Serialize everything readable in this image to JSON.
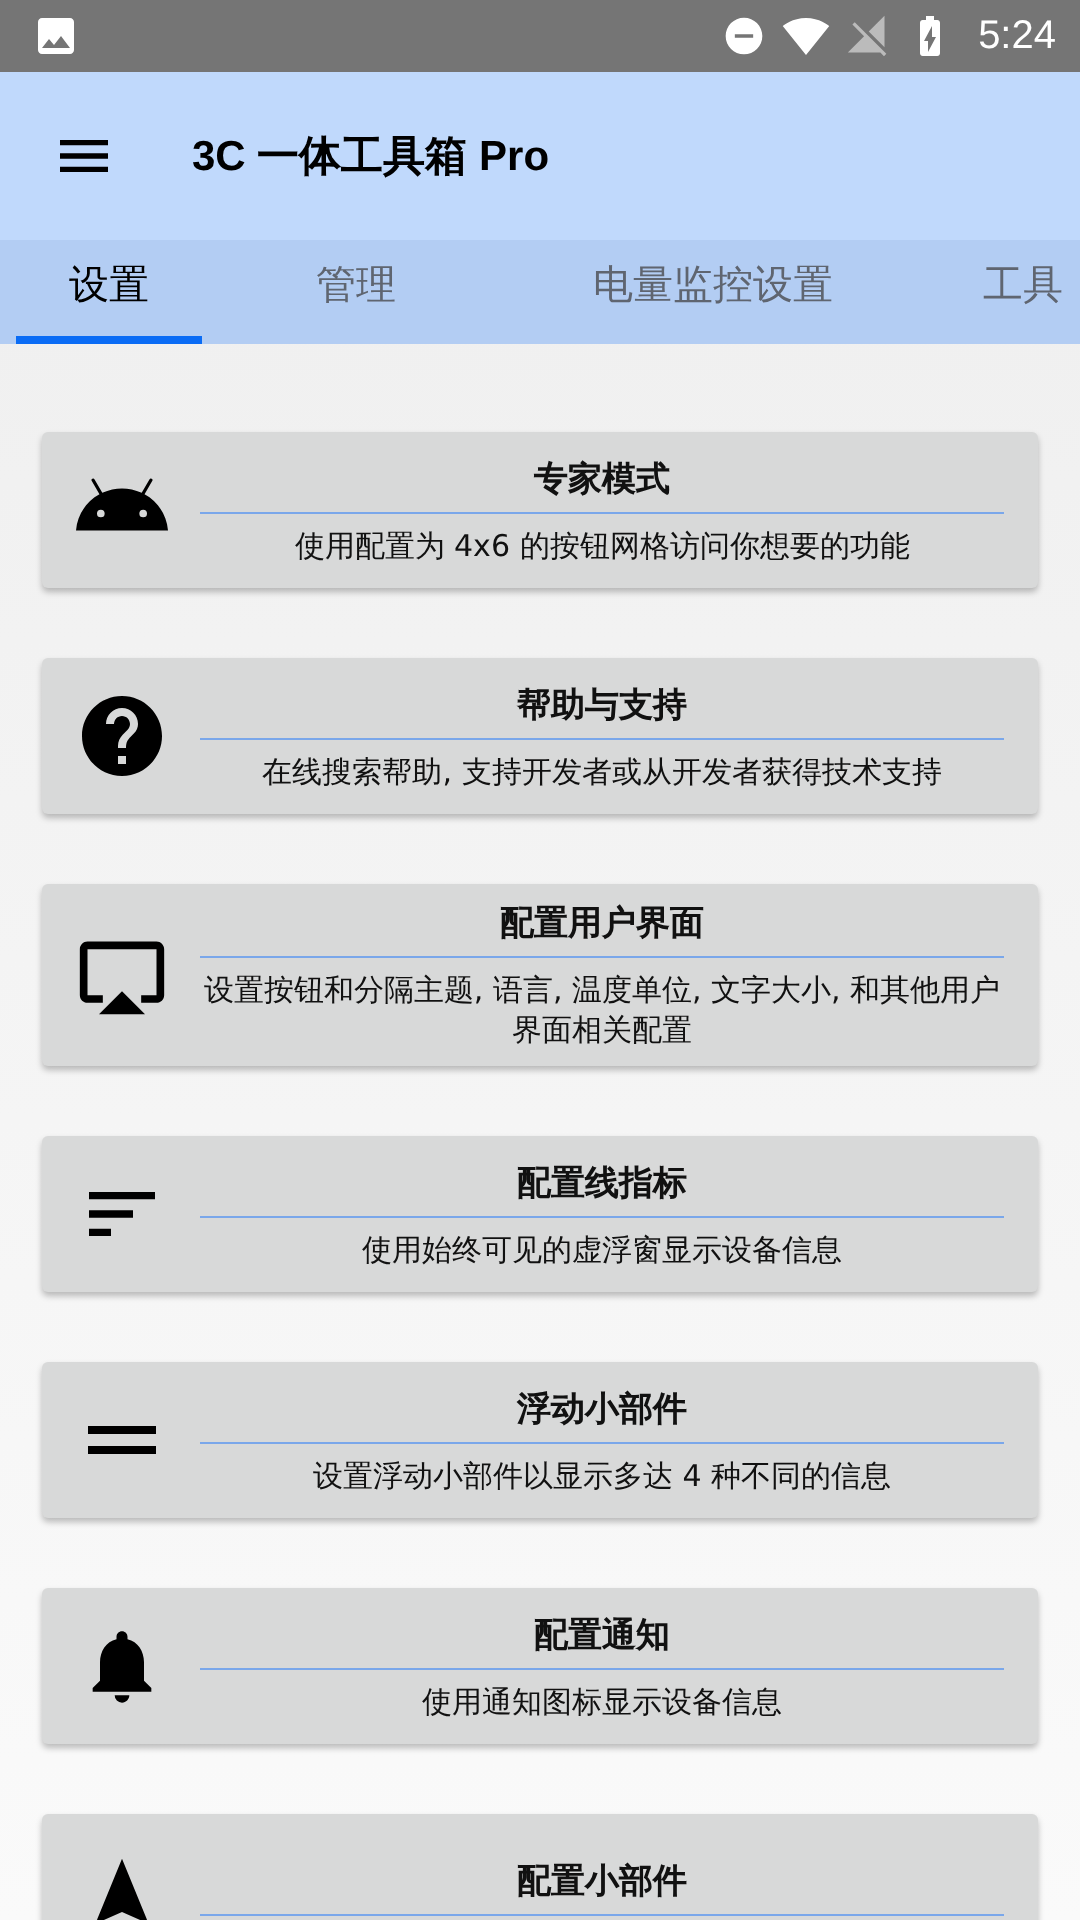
{
  "status_bar": {
    "time": "5:24"
  },
  "app_bar": {
    "title": "3C 一体工具箱 Pro"
  },
  "tabs": [
    {
      "label": "设置",
      "selected": true
    },
    {
      "label": "管理",
      "selected": false
    },
    {
      "label": "电量监控设置",
      "selected": false
    },
    {
      "label": "工具",
      "selected": false
    }
  ],
  "cards": [
    {
      "kind": "android",
      "title": "专家模式",
      "description": "使用配置为 4x6 的按钮网格访问你想要的功能"
    },
    {
      "kind": "help",
      "title": "帮助与支持",
      "description": "在线搜索帮助, 支持开发者或从开发者获得技术支持"
    },
    {
      "kind": "screen",
      "title": "配置用户界面",
      "description": "设置按钮和分隔主题, 语言, 温度单位, 文字大小, 和其他用户界面相关配置"
    },
    {
      "kind": "lines",
      "title": "配置线指标",
      "description": "使用始终可见的虚浮窗显示设备信息"
    },
    {
      "kind": "handle",
      "title": "浮动小部件",
      "description": "设置浮动小部件以显示多达 4 种不同的信息"
    },
    {
      "kind": "bell",
      "title": "配置通知",
      "description": "使用通知图标显示设备信息"
    },
    {
      "kind": "arrow",
      "title": "配置小部件"
    }
  ]
}
